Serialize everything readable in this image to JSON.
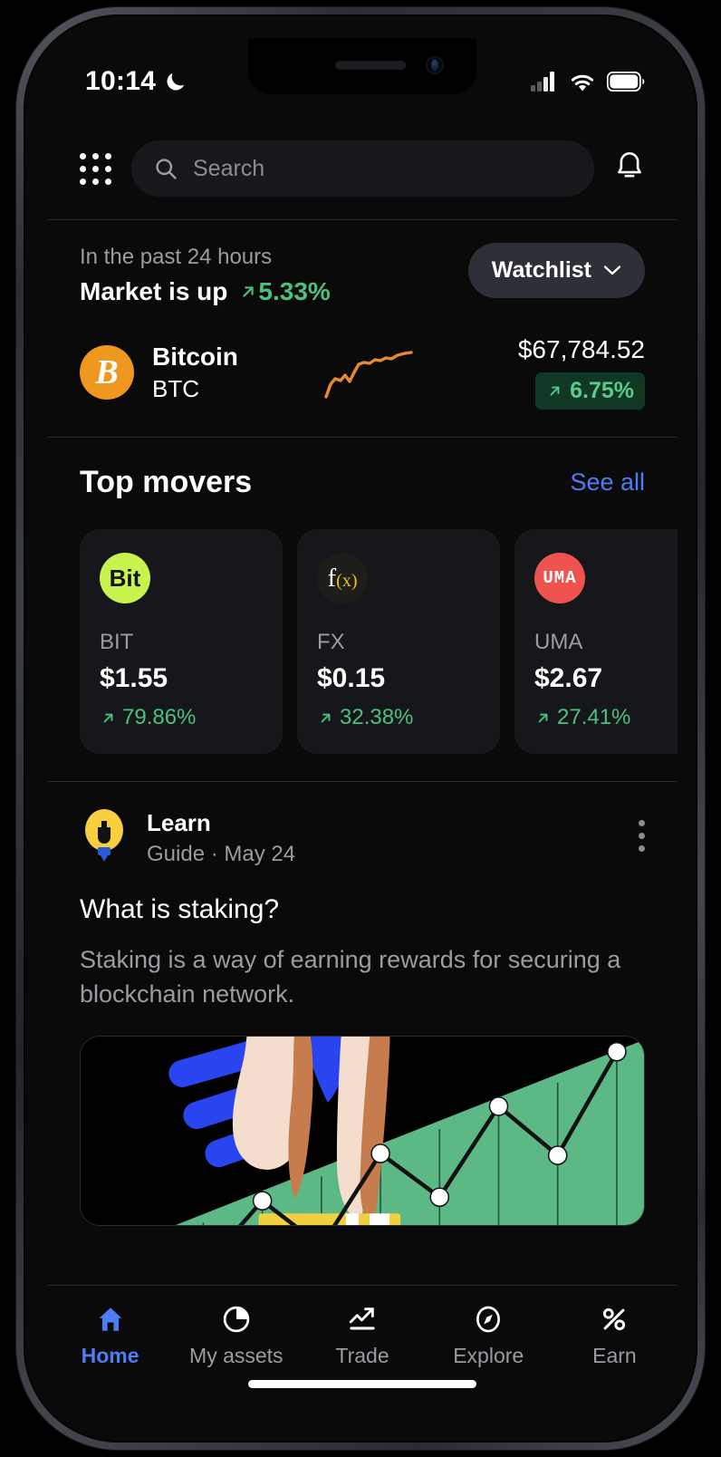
{
  "status_bar": {
    "time": "10:14",
    "dnd_icon": "crescent-moon-icon",
    "cellular_icon": "cellular-signal-icon",
    "wifi_icon": "wifi-icon",
    "battery_icon": "battery-full-icon"
  },
  "header": {
    "grid_icon": "app-grid-icon",
    "search_icon": "search-icon",
    "search_placeholder": "Search",
    "search_value": "",
    "bell_icon": "notification-bell-icon"
  },
  "market": {
    "subtitle": "In the past 24 hours",
    "title": "Market is up",
    "change": "5.33%",
    "change_arrow": "arrow-up-right-icon",
    "watchlist_label": "Watchlist",
    "watchlist_chevron": "chevron-down-icon",
    "coin": {
      "logo_symbol": "B",
      "logo_color": "#f0971f",
      "name": "Bitcoin",
      "symbol": "BTC",
      "price": "$67,784.52",
      "change": "6.75%",
      "change_arrow": "arrow-up-right-icon",
      "sparkline_color": "#e8892b"
    }
  },
  "top_movers": {
    "title": "Top movers",
    "see_all_label": "See all",
    "cards": [
      {
        "symbol": "BIT",
        "price": "$1.55",
        "change": "79.86%",
        "logo_text": "Bit",
        "logo_bg": "#c8f24e",
        "logo_fg": "#121212"
      },
      {
        "symbol": "FX",
        "price": "$0.15",
        "change": "32.38%",
        "logo_text": "f(x)",
        "logo_bg": "#1e1d19",
        "logo_fg": "#ffffff"
      },
      {
        "symbol": "UMA",
        "price": "$2.67",
        "change": "27.41%",
        "logo_text": "UMA",
        "logo_bg": "#ef5350",
        "logo_fg": "#ffffff"
      }
    ]
  },
  "learn": {
    "icon": "lightbulb-icon",
    "label": "Learn",
    "meta": "Guide · May 24",
    "menu_icon": "kebab-menu-icon",
    "headline": "What is staking?",
    "body": "Staking is a way of earning rewards for securing a blockchain network.",
    "illustration": "hand-stacking-coins-with-rising-chart-illustration"
  },
  "bottom_nav": {
    "items": [
      {
        "label": "Home",
        "icon": "home-icon",
        "active": true
      },
      {
        "label": "My assets",
        "icon": "pie-chart-icon",
        "active": false
      },
      {
        "label": "Trade",
        "icon": "trend-up-icon",
        "active": false
      },
      {
        "label": "Explore",
        "icon": "compass-icon",
        "active": false
      },
      {
        "label": "Earn",
        "icon": "percent-icon",
        "active": false
      }
    ]
  },
  "colors": {
    "accent_blue": "#4d7cf5",
    "positive_green": "#4ec07e",
    "badge_green_bg": "#103824",
    "background": "#0a0a0a",
    "card": "#16171b"
  }
}
